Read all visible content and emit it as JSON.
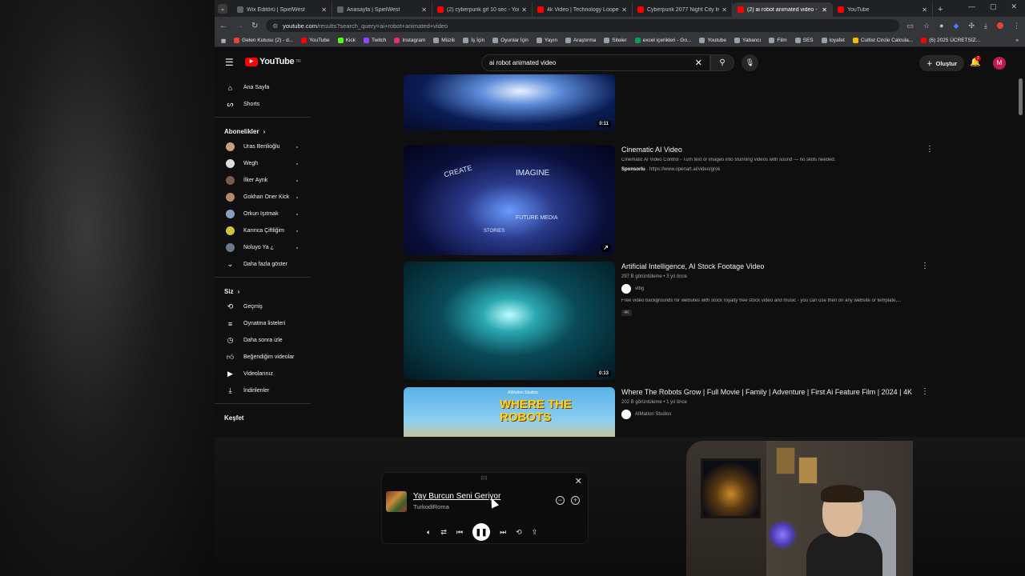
{
  "browser": {
    "tabs": [
      {
        "title": "Wix Editörü | SpielWest",
        "color": "#5f6368"
      },
      {
        "title": "Anasayfa | SpielWest",
        "color": "#5f6368"
      },
      {
        "title": "(2) cyberpunk gif 10 sec - YouT",
        "color": "#ff0000"
      },
      {
        "title": "4k Video | Technology Looped",
        "color": "#ff0000"
      },
      {
        "title": "Cyberpunk 2077 Night City live",
        "color": "#ff0000"
      },
      {
        "title": "(2) ai robot animated video - Yo",
        "color": "#ff0000"
      },
      {
        "title": "YouTube",
        "color": "#ff0000"
      }
    ],
    "active_tab": 5,
    "url": "youtube.com",
    "url_rest": "/results?search_query=ai+robot+animated+video",
    "bookmarks": [
      {
        "label": "Gelen Kutusu (2) - d...",
        "color": "#ea4335"
      },
      {
        "label": "YouTube",
        "color": "#ff0000"
      },
      {
        "label": "Kick",
        "color": "#53fc18"
      },
      {
        "label": "Twitch",
        "color": "#9146ff"
      },
      {
        "label": "Instagram",
        "color": "#e1306c"
      },
      {
        "label": "Müzik",
        "color": "#9aa0a6"
      },
      {
        "label": "İş İçin",
        "color": "#9aa0a6"
      },
      {
        "label": "Oyunlar İçin",
        "color": "#9aa0a6"
      },
      {
        "label": "Yayın",
        "color": "#9aa0a6"
      },
      {
        "label": "Araştırma",
        "color": "#9aa0a6"
      },
      {
        "label": "Siteler",
        "color": "#9aa0a6"
      },
      {
        "label": "excel içerikleri - Go...",
        "color": "#0f9d58"
      },
      {
        "label": "Youtube",
        "color": "#9aa0a6"
      },
      {
        "label": "Yabancı",
        "color": "#9aa0a6"
      },
      {
        "label": "Film",
        "color": "#9aa0a6"
      },
      {
        "label": "SES",
        "color": "#9aa0a6"
      },
      {
        "label": "loyafet",
        "color": "#9aa0a6"
      },
      {
        "label": "Cultist Circle Calcula...",
        "color": "#fbbc04"
      },
      {
        "label": "(6) 2025 ÜCRETSİZ...",
        "color": "#ff0000"
      }
    ]
  },
  "yt": {
    "logo": "YouTube",
    "logo_sup": "TR",
    "search_value": "ai robot animated video",
    "create_label": "Oluştur",
    "bell_count": "2",
    "avatar_letter": "M"
  },
  "sidebar": {
    "home": "Ana Sayfa",
    "shorts": "Shorts",
    "subs_header": "Abonelikler",
    "subs": [
      {
        "name": "Uras Benlioğlu",
        "color": "#c8a07a"
      },
      {
        "name": "Wegh",
        "color": "#dddddd"
      },
      {
        "name": "İlker Aynk",
        "color": "#7a5a4a"
      },
      {
        "name": "Gokhan Oner Kick",
        "color": "#b08a6a"
      },
      {
        "name": "Orkun Işıtmak",
        "color": "#8aa0c0"
      },
      {
        "name": "Karınca Çiftliğim",
        "color": "#d4c03a"
      },
      {
        "name": "Noluyo Ya ¿",
        "color": "#6a7a8a"
      }
    ],
    "more": "Daha fazla göster",
    "you_header": "Siz",
    "you_items": [
      {
        "label": "Geçmiş",
        "icon": "history-icon"
      },
      {
        "label": "Oynatma listeleri",
        "icon": "playlist-icon"
      },
      {
        "label": "Daha sonra izle",
        "icon": "clock-icon"
      },
      {
        "label": "Beğendiğim videolar",
        "icon": "thumbs-up-icon"
      },
      {
        "label": "Videolarınız",
        "icon": "video-icon"
      },
      {
        "label": "İndirilenler",
        "icon": "download-icon"
      }
    ],
    "explore_header": "Keşfet"
  },
  "results": [
    {
      "title": "",
      "duration": "0:11"
    },
    {
      "title": "Cinematic AI Video",
      "desc": "Cinematic AI Video Control - Turn text or images into stunning videos with sound — no skills needed.",
      "sponsor_label": "Sponsorlu",
      "sponsor_url": "https://www.openart.ai/video/grok"
    },
    {
      "title": "Artificial Intelligence, AI Stock Footage Video",
      "meta": "297 B görüntüleme • 3 yıl önce",
      "channel": "vibg",
      "desc": "Free video backgrounds for websites with stock royalty free stock video and music - you can use then on any website or template,...",
      "badge": "4K",
      "duration": "0:13"
    },
    {
      "title": "Where The Robots Grow | Full Movie | Family | Adventure | First Ai Feature Film | 2024 | 4K",
      "meta": "202 B görüntüleme • 1 yıl önce",
      "channel": "AIMation Studios",
      "thumb_text": "WHERE THE ROBOTS",
      "thumb_studio": "AIMation Studios"
    }
  ],
  "thumb1_words": [
    "CREATE",
    "IMAGINE",
    "FUTURE MEDIA",
    "STORIES"
  ],
  "player": {
    "song": "Yay Burcun Seni Geriyor",
    "artist": "TurkodiRoma"
  }
}
